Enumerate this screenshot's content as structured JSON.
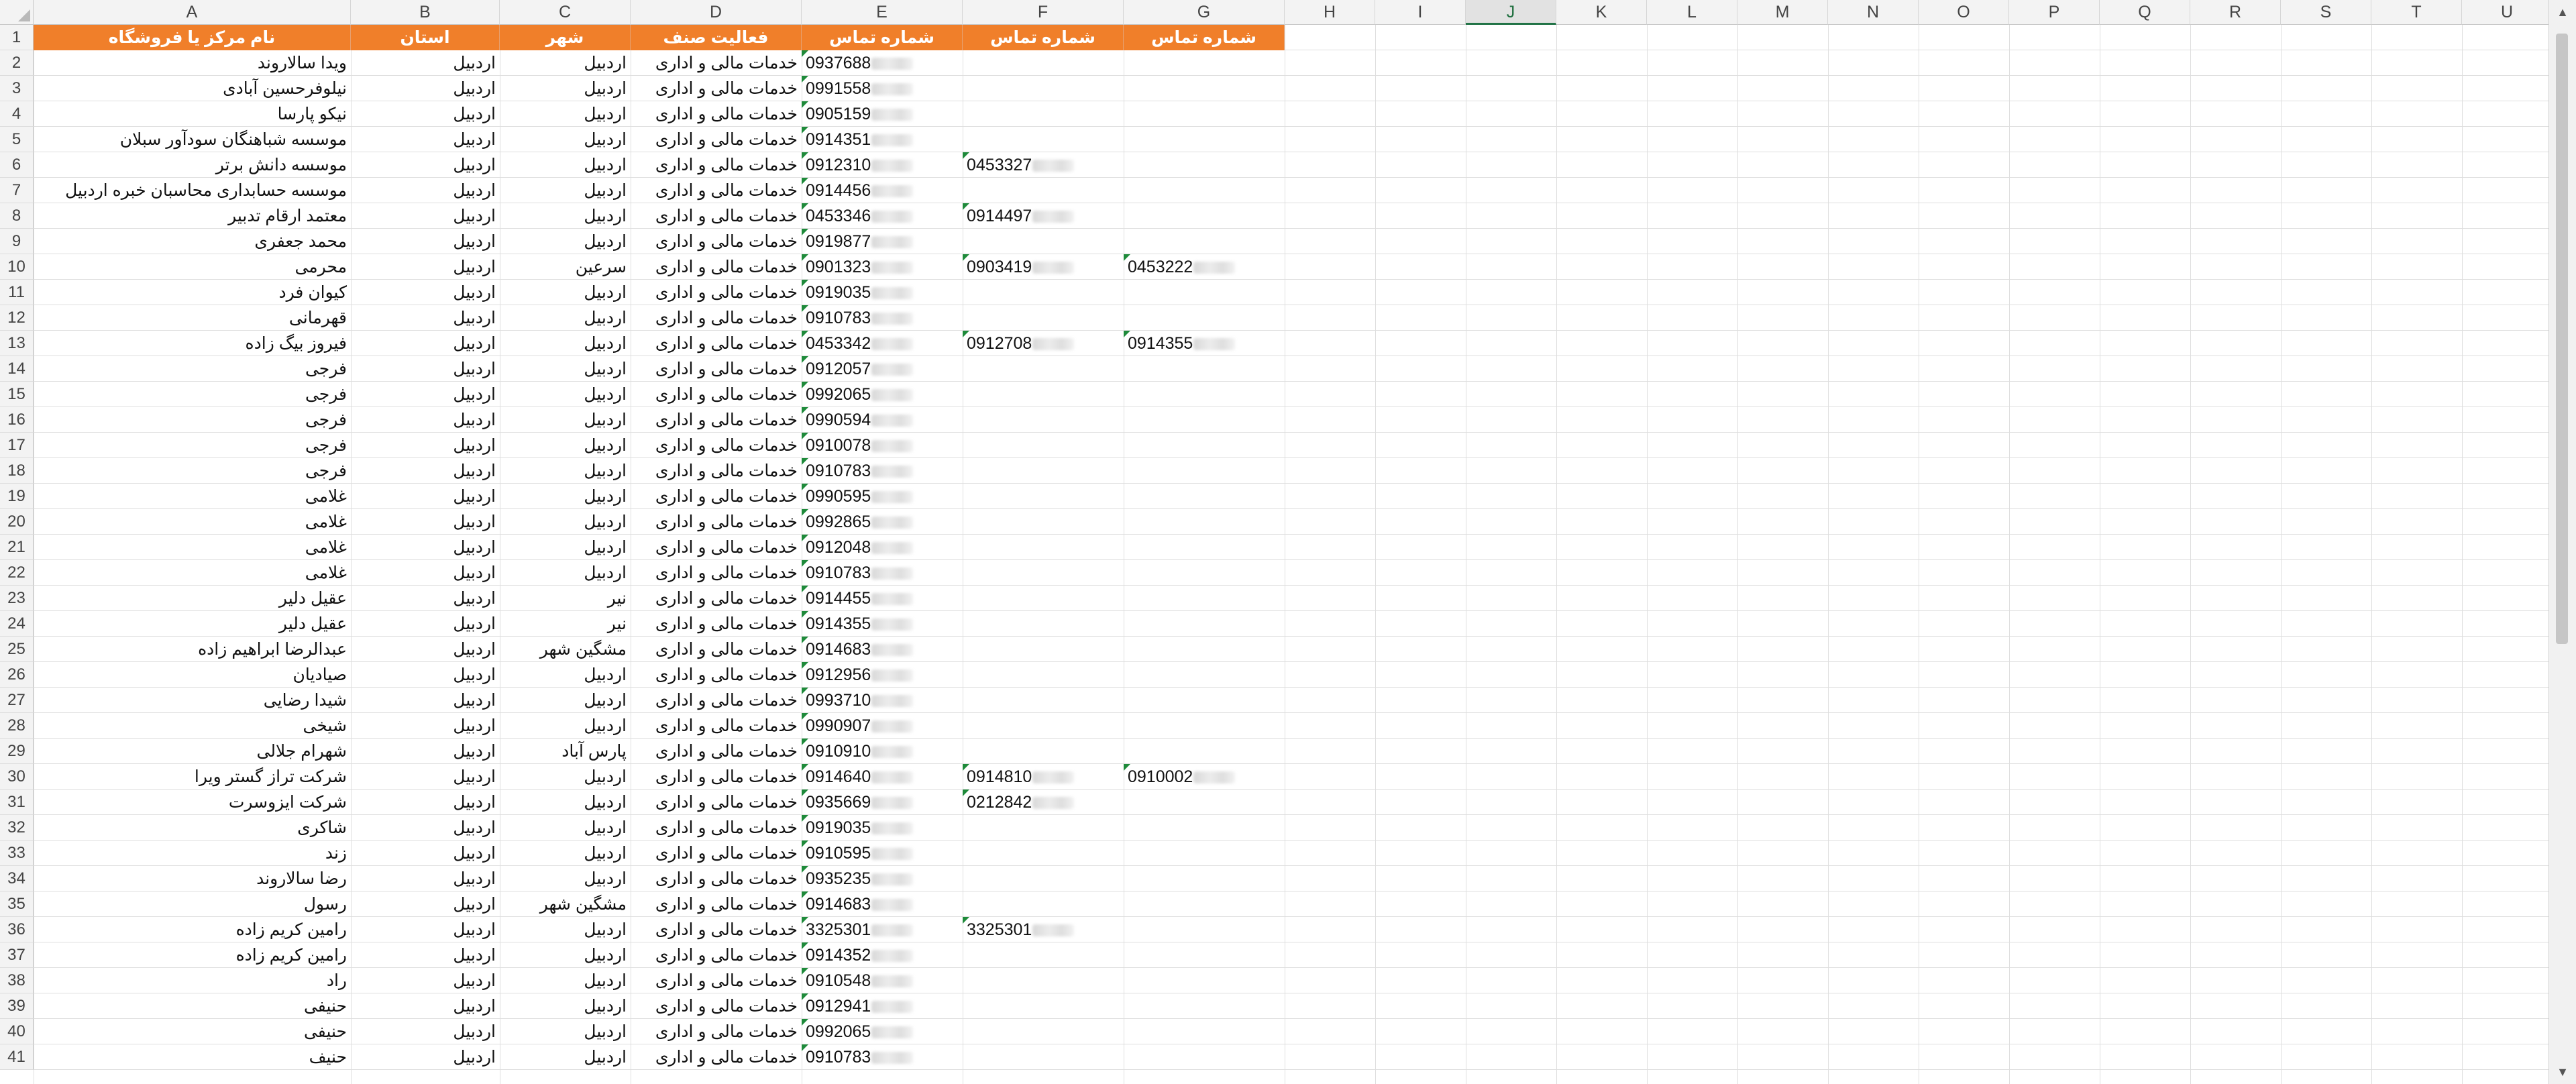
{
  "columns": [
    "A",
    "B",
    "C",
    "D",
    "E",
    "F",
    "G",
    "H",
    "I",
    "J",
    "K",
    "L",
    "M",
    "N",
    "O",
    "P",
    "Q",
    "R",
    "S",
    "T",
    "U"
  ],
  "selected_column": "J",
  "headers": {
    "A": "نام مرکز یا فروشگاه",
    "B": "استان",
    "C": "شهر",
    "D": "فعالیت صنف",
    "E": "شماره تماس",
    "F": "شماره تماس",
    "G": "شماره تماس"
  },
  "rows": [
    {
      "n": "2",
      "a": "ویدا سالاروند",
      "b": "اردبیل",
      "c": "اردبیل",
      "d": "خدمات مالی و اداری",
      "e": "0937688"
    },
    {
      "n": "3",
      "a": "نیلوفرحسین آبادی",
      "b": "اردبیل",
      "c": "اردبیل",
      "d": "خدمات مالی و اداری",
      "e": "0991558"
    },
    {
      "n": "4",
      "a": "نیکو پارسا",
      "b": "اردبیل",
      "c": "اردبیل",
      "d": "خدمات مالی و اداری",
      "e": "0905159"
    },
    {
      "n": "5",
      "a": "موسسه شباهنگان سودآور سبلان",
      "b": "اردبیل",
      "c": "اردبیل",
      "d": "خدمات مالی و اداری",
      "e": "0914351"
    },
    {
      "n": "6",
      "a": "موسسه دانش برتر",
      "b": "اردبیل",
      "c": "اردبیل",
      "d": "خدمات مالی و اداری",
      "e": "0912310",
      "f": "0453327"
    },
    {
      "n": "7",
      "a": "موسسه حسابداری محاسبان خبره اردبیل",
      "b": "اردبیل",
      "c": "اردبیل",
      "d": "خدمات مالی و اداری",
      "e": "0914456"
    },
    {
      "n": "8",
      "a": "معتمد ارقام تدبیر",
      "b": "اردبیل",
      "c": "اردبیل",
      "d": "خدمات مالی و اداری",
      "e": "0453346",
      "f": "0914497"
    },
    {
      "n": "9",
      "a": "محمد جعفری",
      "b": "اردبیل",
      "c": "اردبیل",
      "d": "خدمات مالی و اداری",
      "e": "0919877"
    },
    {
      "n": "10",
      "a": "محرمی",
      "b": "اردبیل",
      "c": "سرعین",
      "d": "خدمات مالی و اداری",
      "e": "0901323",
      "f": "0903419",
      "g": "0453222"
    },
    {
      "n": "11",
      "a": "کیوان فرد",
      "b": "اردبیل",
      "c": "اردبیل",
      "d": "خدمات مالی و اداری",
      "e": "0919035"
    },
    {
      "n": "12",
      "a": "قهرمانی",
      "b": "اردبیل",
      "c": "اردبیل",
      "d": "خدمات مالی و اداری",
      "e": "0910783"
    },
    {
      "n": "13",
      "a": "فیروز بیگ زاده",
      "b": "اردبیل",
      "c": "اردبیل",
      "d": "خدمات مالی و اداری",
      "e": "0453342",
      "f": "0912708",
      "g": "0914355"
    },
    {
      "n": "14",
      "a": "فرجی",
      "b": "اردبیل",
      "c": "اردبیل",
      "d": "خدمات مالی و اداری",
      "e": "0912057"
    },
    {
      "n": "15",
      "a": "فرجی",
      "b": "اردبیل",
      "c": "اردبیل",
      "d": "خدمات مالی و اداری",
      "e": "0992065"
    },
    {
      "n": "16",
      "a": "فرجی",
      "b": "اردبیل",
      "c": "اردبیل",
      "d": "خدمات مالی و اداری",
      "e": "0990594"
    },
    {
      "n": "17",
      "a": "فرجی",
      "b": "اردبیل",
      "c": "اردبیل",
      "d": "خدمات مالی و اداری",
      "e": "0910078"
    },
    {
      "n": "18",
      "a": "فرجی",
      "b": "اردبیل",
      "c": "اردبیل",
      "d": "خدمات مالی و اداری",
      "e": "0910783"
    },
    {
      "n": "19",
      "a": "غلامی",
      "b": "اردبیل",
      "c": "اردبیل",
      "d": "خدمات مالی و اداری",
      "e": "0990595"
    },
    {
      "n": "20",
      "a": "غلامی",
      "b": "اردبیل",
      "c": "اردبیل",
      "d": "خدمات مالی و اداری",
      "e": "0992865"
    },
    {
      "n": "21",
      "a": "غلامی",
      "b": "اردبیل",
      "c": "اردبیل",
      "d": "خدمات مالی و اداری",
      "e": "0912048"
    },
    {
      "n": "22",
      "a": "غلامی",
      "b": "اردبیل",
      "c": "اردبیل",
      "d": "خدمات مالی و اداری",
      "e": "0910783"
    },
    {
      "n": "23",
      "a": "عقیل دلیر",
      "b": "اردبیل",
      "c": "نیر",
      "d": "خدمات مالی و اداری",
      "e": "0914455"
    },
    {
      "n": "24",
      "a": "عقیل دلیر",
      "b": "اردبیل",
      "c": "نیر",
      "d": "خدمات مالی و اداری",
      "e": "0914355"
    },
    {
      "n": "25",
      "a": "عبدالرضا ابراهیم زاده",
      "b": "اردبیل",
      "c": "مشگین شهر",
      "d": "خدمات مالی و اداری",
      "e": "0914683"
    },
    {
      "n": "26",
      "a": "صیادیان",
      "b": "اردبیل",
      "c": "اردبیل",
      "d": "خدمات مالی و اداری",
      "e": "0912956"
    },
    {
      "n": "27",
      "a": "شیدا رضایی",
      "b": "اردبیل",
      "c": "اردبیل",
      "d": "خدمات مالی و اداری",
      "e": "0993710"
    },
    {
      "n": "28",
      "a": "شیخی",
      "b": "اردبیل",
      "c": "اردبیل",
      "d": "خدمات مالی و اداری",
      "e": "0990907"
    },
    {
      "n": "29",
      "a": "شهرام جلالی",
      "b": "اردبیل",
      "c": "پارس آباد",
      "d": "خدمات مالی و اداری",
      "e": "0910910"
    },
    {
      "n": "30",
      "a": "شرکت تراز گستر ویرا",
      "b": "اردبیل",
      "c": "اردبیل",
      "d": "خدمات مالی و اداری",
      "e": "0914640",
      "f": "0914810",
      "g": "0910002"
    },
    {
      "n": "31",
      "a": "شرکت ایزوسرت",
      "b": "اردبیل",
      "c": "اردبیل",
      "d": "خدمات مالی و اداری",
      "e": "0935669",
      "f": "0212842"
    },
    {
      "n": "32",
      "a": "شاکری",
      "b": "اردبیل",
      "c": "اردبیل",
      "d": "خدمات مالی و اداری",
      "e": "0919035"
    },
    {
      "n": "33",
      "a": "زند",
      "b": "اردبیل",
      "c": "اردبیل",
      "d": "خدمات مالی و اداری",
      "e": "0910595"
    },
    {
      "n": "34",
      "a": "رضا سالاروند",
      "b": "اردبیل",
      "c": "اردبیل",
      "d": "خدمات مالی و اداری",
      "e": "0935235"
    },
    {
      "n": "35",
      "a": "رسول",
      "b": "اردبیل",
      "c": "مشگین شهر",
      "d": "خدمات مالی و اداری",
      "e": "0914683"
    },
    {
      "n": "36",
      "a": "رامین کریم زاده",
      "b": "اردبیل",
      "c": "اردبیل",
      "d": "خدمات مالی و اداری",
      "e": "3325301",
      "f": "3325301"
    },
    {
      "n": "37",
      "a": "رامین کریم زاده",
      "b": "اردبیل",
      "c": "اردبیل",
      "d": "خدمات مالی و اداری",
      "e": "0914352"
    },
    {
      "n": "38",
      "a": "راد",
      "b": "اردبیل",
      "c": "اردبیل",
      "d": "خدمات مالی و اداری",
      "e": "0910548"
    },
    {
      "n": "39",
      "a": "حنیفی",
      "b": "اردبیل",
      "c": "اردبیل",
      "d": "خدمات مالی و اداری",
      "e": "0912941"
    },
    {
      "n": "40",
      "a": "حنیفی",
      "b": "اردبیل",
      "c": "اردبیل",
      "d": "خدمات مالی و اداری",
      "e": "0992065"
    },
    {
      "n": "41",
      "a": "حنیف",
      "b": "اردبیل",
      "c": "اردبیل",
      "d": "خدمات مالی و اداری",
      "e": "0910783"
    }
  ]
}
